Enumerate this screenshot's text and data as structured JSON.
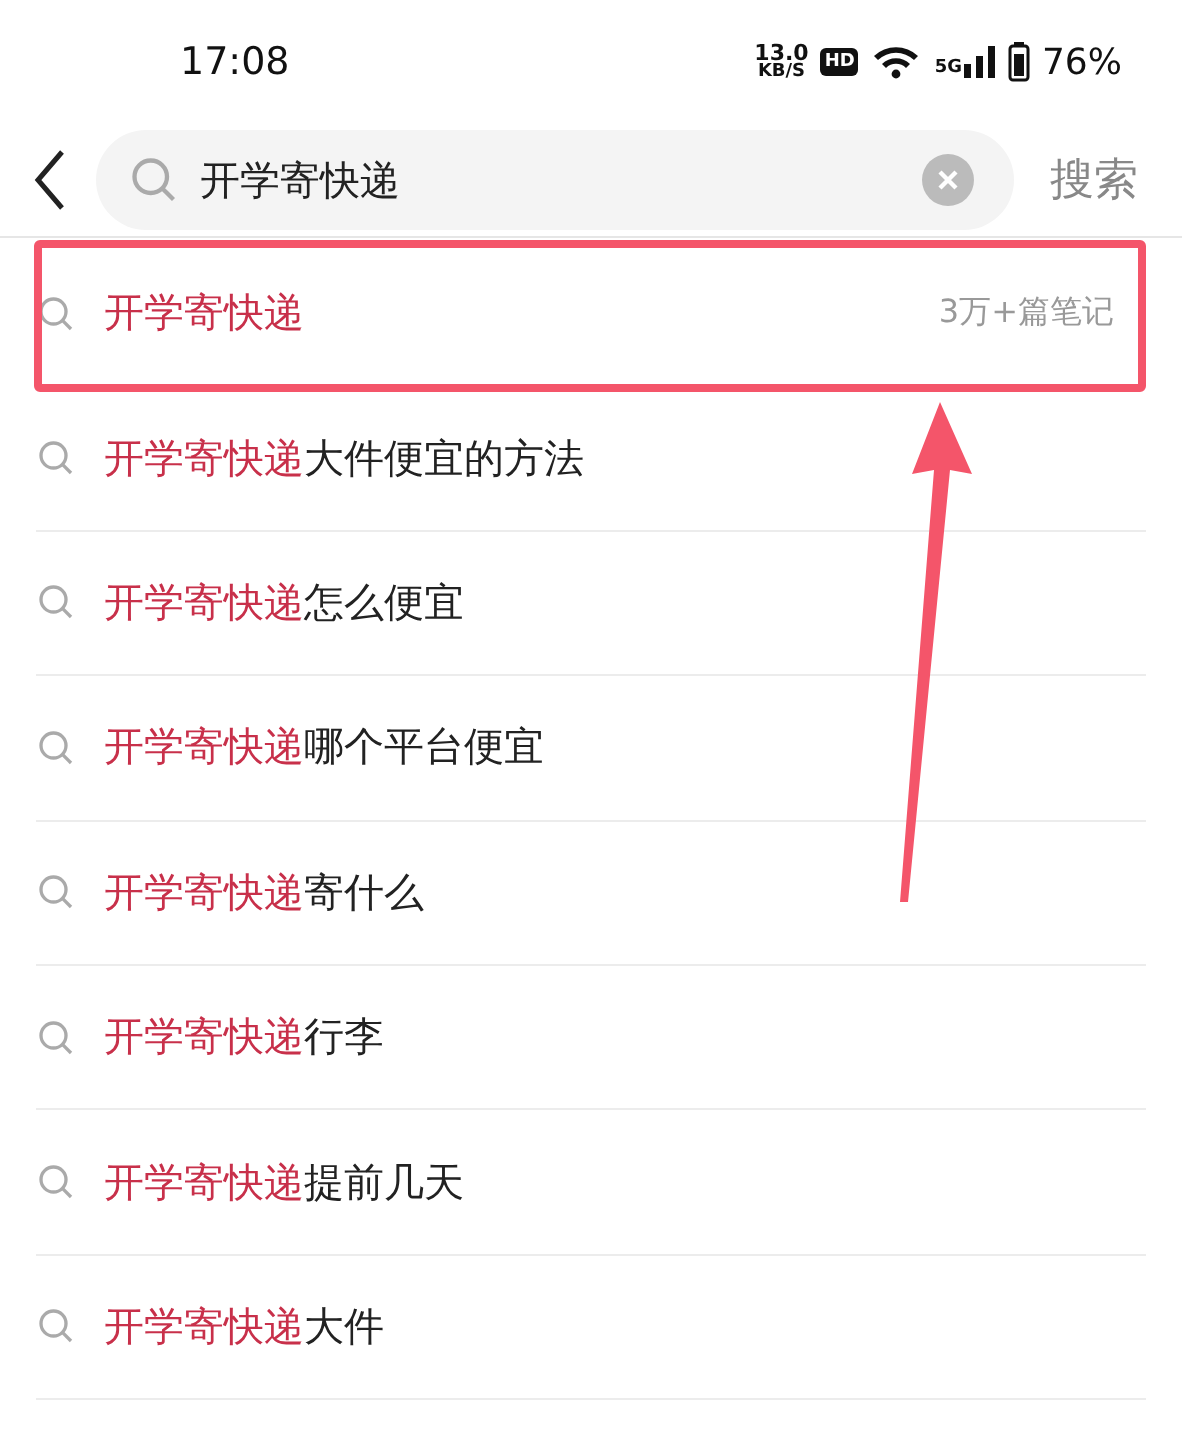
{
  "status_bar": {
    "time": "17:08",
    "speed_value": "13.0",
    "speed_unit": "KB/S",
    "hd_badge": "HD",
    "network": "5G",
    "battery": "76%"
  },
  "search": {
    "value": "开学寄快递",
    "submit": "搜索"
  },
  "suggestions": [
    {
      "match": "开学寄快递",
      "count": "3万+篇笔记",
      "highlighted": true
    },
    {
      "match": "开学寄快递",
      "rest": "大件便宜的方法",
      "highlighted": false
    },
    {
      "match": "开学寄快递",
      "rest": "怎么便宜",
      "highlighted": false
    },
    {
      "match": "开学寄快递",
      "rest": "哪个平台便宜",
      "highlighted": false
    },
    {
      "match": "开学寄快递",
      "rest": "寄什么",
      "highlighted": false
    },
    {
      "match": "开学寄快递",
      "rest": "行李",
      "highlighted": false
    },
    {
      "match": "开学寄快递",
      "rest": "提前几天",
      "highlighted": false
    },
    {
      "match": "开学寄快递",
      "rest": "大件",
      "highlighted": false
    }
  ]
}
